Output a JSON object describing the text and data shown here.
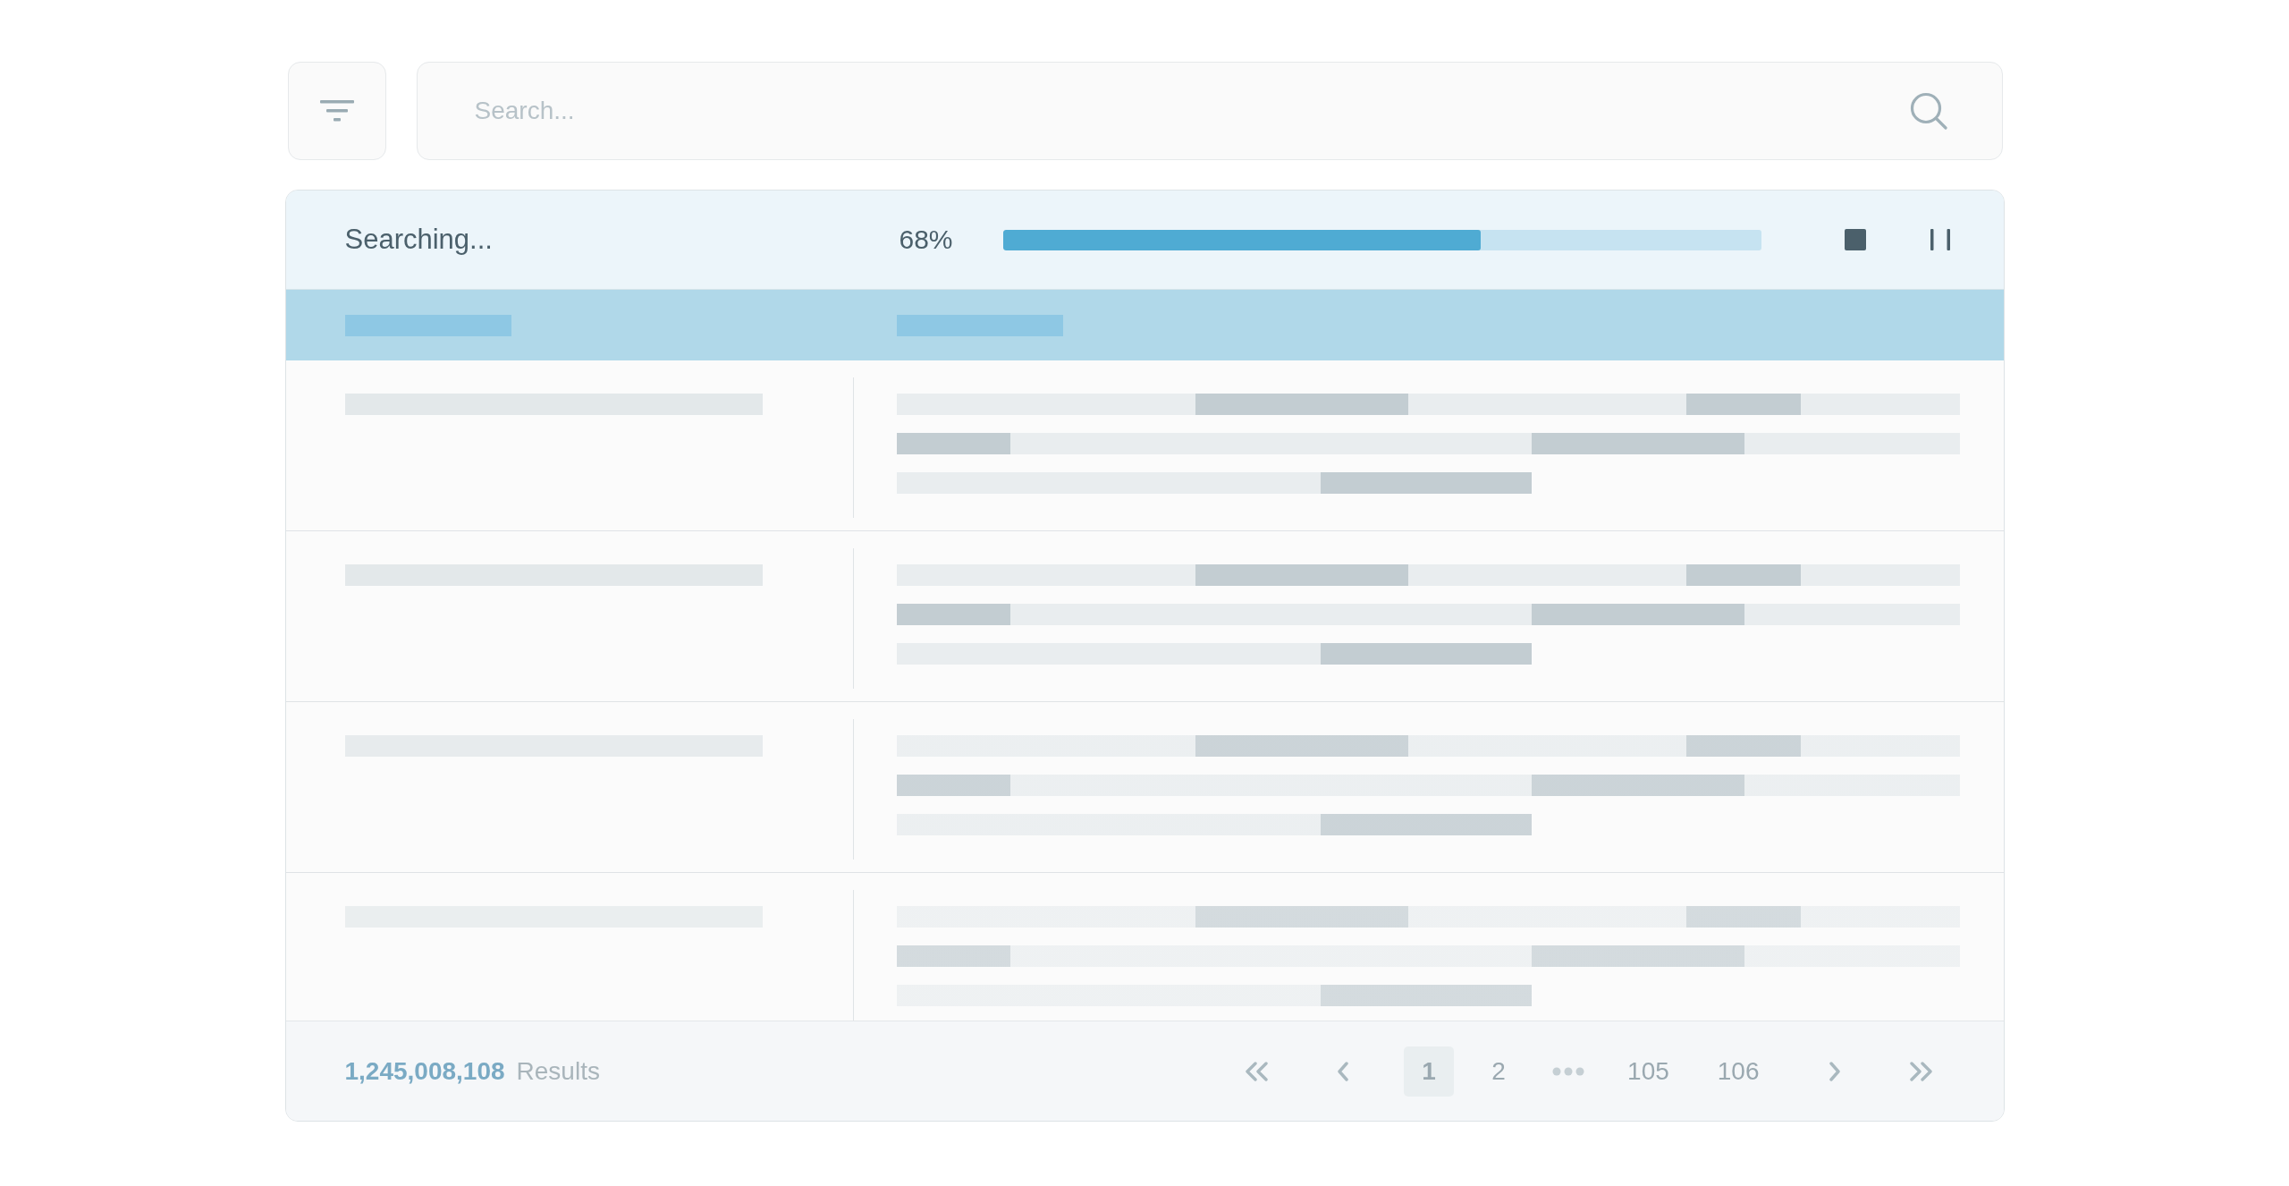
{
  "toolbar": {
    "search": {
      "placeholder": "Search..."
    }
  },
  "status": {
    "label": "Searching...",
    "percent": "68%",
    "level": 0.63
  },
  "table": {
    "columns": [
      {
        "kind": "skeleton"
      },
      {
        "kind": "skeleton"
      }
    ],
    "rows": [
      {
        "kind": "skeleton"
      },
      {
        "kind": "skeleton"
      },
      {
        "kind": "skeleton"
      },
      {
        "kind": "skeleton"
      }
    ]
  },
  "footer": {
    "count": "1,245,008,108",
    "count_label": "Results",
    "pages": [
      {
        "kind": "page",
        "label": "1",
        "selected": true
      },
      {
        "kind": "page",
        "label": "2",
        "selected": false
      },
      {
        "kind": "ellipsis",
        "selected": false
      },
      {
        "kind": "page",
        "label": "105",
        "selected": false
      },
      {
        "kind": "page",
        "label": "106",
        "selected": false
      }
    ]
  }
}
